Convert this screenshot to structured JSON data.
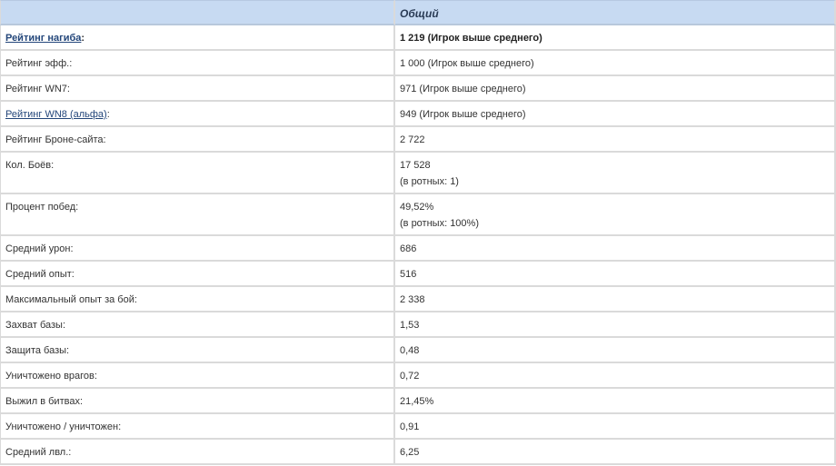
{
  "header": {
    "label_col": "",
    "value_col": "Общий"
  },
  "rows": [
    {
      "label": "Рейтинг нагиба",
      "suffix": ":",
      "link": true,
      "bold": true,
      "value": "1 219 (Игрок выше среднего)"
    },
    {
      "label": "Рейтинг эфф.:",
      "value": "1 000 (Игрок выше среднего)"
    },
    {
      "label": "Рейтинг WN7:",
      "value": "971 (Игрок выше среднего)"
    },
    {
      "label": "Рейтинг WN8 (альфа)",
      "suffix": ":",
      "link": true,
      "value": "949 (Игрок выше среднего)"
    },
    {
      "label": "Рейтинг Броне-сайта:",
      "value": "2 722"
    },
    {
      "label": "Кол. Боёв:",
      "value": "17 528",
      "value2": "(в ротных: 1)"
    },
    {
      "label": "Процент побед:",
      "value": "49,52%",
      "value2": "(в ротных: 100%)"
    },
    {
      "label": "Средний урон:",
      "value": "686"
    },
    {
      "label": "Средний опыт:",
      "value": "516"
    },
    {
      "label": "Максимальный опыт за бой:",
      "value": "2 338"
    },
    {
      "label": "Захват базы:",
      "value": "1,53"
    },
    {
      "label": "Защита базы:",
      "value": "0,48"
    },
    {
      "label": "Уничтожено врагов:",
      "value": "0,72"
    },
    {
      "label": "Выжил в битвах:",
      "value": "21,45%"
    },
    {
      "label": "Уничтожено / уничтожен:",
      "value": "0,91"
    },
    {
      "label": "Средний лвл.:",
      "value": "6,25"
    }
  ],
  "colors": {
    "header_bg": "#c7daf2",
    "link": "#23467a",
    "border": "#dadada"
  }
}
